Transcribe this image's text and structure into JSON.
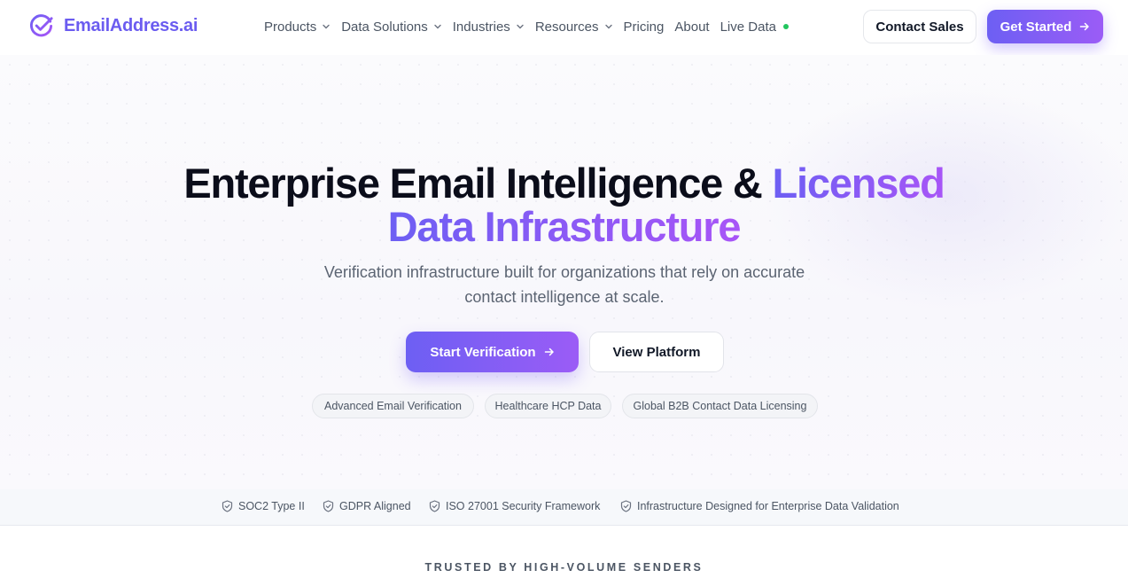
{
  "brand": {
    "name": "EmailAddress.ai",
    "logo_icon": "check-circle-icon",
    "accent_color": "#6d5ff3",
    "accent_color_end": "#a855f7",
    "live_indicator_color": "#22c55e"
  },
  "nav": {
    "items": [
      {
        "label": "Products",
        "has_dropdown": true
      },
      {
        "label": "Data Solutions",
        "has_dropdown": true
      },
      {
        "label": "Industries",
        "has_dropdown": true
      },
      {
        "label": "Resources",
        "has_dropdown": true
      },
      {
        "label": "Pricing",
        "has_dropdown": false
      },
      {
        "label": "About",
        "has_dropdown": false
      },
      {
        "label": "Live Data",
        "has_dropdown": false,
        "live": true
      }
    ],
    "contact_label": "Contact Sales",
    "get_started_label": "Get Started"
  },
  "hero": {
    "title_part1": "Enterprise Email Intelligence & ",
    "title_accent_line1": "Licensed",
    "title_accent_line2": "Data Infrastructure",
    "subtitle": "Verification infrastructure built for organizations that rely on accurate contact intelligence at scale.",
    "primary_cta": "Start Verification",
    "secondary_cta": "View Platform",
    "chips": [
      "Advanced Email Verification",
      "Healthcare HCP Data",
      "Global B2B Contact Data Licensing"
    ]
  },
  "trust": {
    "icon": "shield-check-icon",
    "items": [
      "SOC2 Type II",
      "GDPR Aligned",
      "ISO 27001 Security Framework",
      "Infrastructure Designed for Enterprise Data Validation"
    ]
  },
  "trusted_heading": "TRUSTED BY HIGH-VOLUME SENDERS"
}
